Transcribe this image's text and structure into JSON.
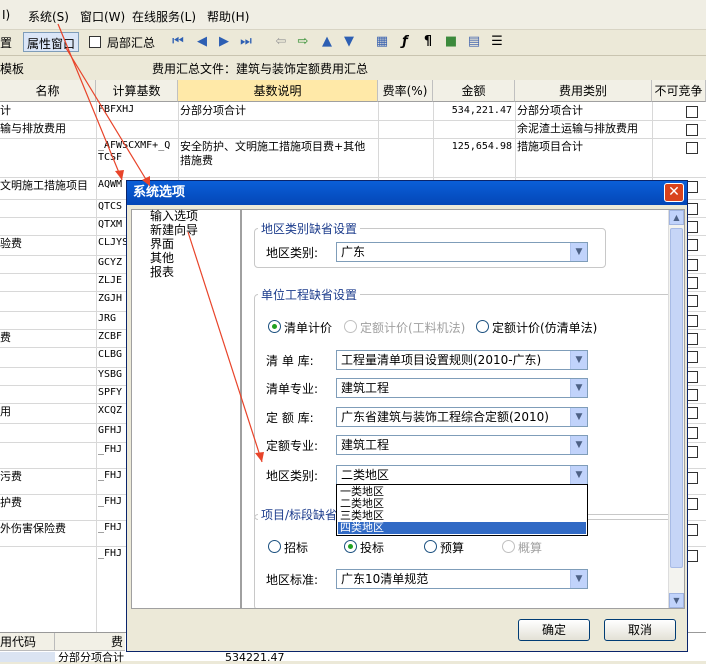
{
  "menubar": {
    "items": [
      "I)",
      "系统(S)",
      "窗口(W)",
      "在线服务(L)",
      "帮助(H)"
    ]
  },
  "toolbar": {
    "left_text": "置",
    "property_window": "属性窗口",
    "partial_summary": "局部汇总"
  },
  "infobar": {
    "left_text": "模板",
    "fee_summary": "费用汇总文件：建筑与装饰定额费用汇总"
  },
  "grid": {
    "headers": [
      "名称",
      "计算基数",
      "基数说明",
      "费率(%)",
      "金额",
      "费用类别",
      "不可竞争"
    ],
    "rows": [
      {
        "name": "计",
        "base": "FBFXHJ",
        "desc": "分部分项合计",
        "amount": "534,221.47",
        "category": "分部分项合计"
      },
      {
        "name": "输与排放费用",
        "base": "",
        "desc": "",
        "amount": "",
        "category": "余泥渣土运输与排放费用"
      },
      {
        "name": "",
        "base": "_AFWSCXMF+_Q TCSF",
        "desc": "安全防护、文明施工措施项目费+其他措施费",
        "amount": "125,654.98",
        "category": "措施项目合计"
      },
      {
        "name": "文明施工措施项目",
        "base": "AQWM",
        "desc": "",
        "amount": "",
        "category": ""
      },
      {
        "name": "",
        "base": "QTCS",
        "desc": "",
        "amount": "",
        "category": ""
      },
      {
        "name": "",
        "base": "QTXM",
        "desc": "",
        "amount": "",
        "category": ""
      },
      {
        "name": "验费",
        "base": "CLJYS",
        "desc": "",
        "amount": "",
        "category": ""
      },
      {
        "name": "",
        "base": "GCYZ",
        "desc": "",
        "amount": "",
        "category": ""
      },
      {
        "name": "",
        "base": "ZLJE",
        "desc": "",
        "amount": "",
        "category": ""
      },
      {
        "name": "",
        "base": "ZGJH",
        "desc": "",
        "amount": "",
        "category": ""
      },
      {
        "name": "",
        "base": "JRG",
        "desc": "",
        "amount": "",
        "category": ""
      },
      {
        "name": "费",
        "base": "ZCBF",
        "desc": "",
        "amount": "",
        "category": ""
      },
      {
        "name": "",
        "base": "CLBG",
        "desc": "",
        "amount": "",
        "category": ""
      },
      {
        "name": "",
        "base": "YSBG",
        "desc": "",
        "amount": "",
        "category": ""
      },
      {
        "name": "",
        "base": "SPFY",
        "desc": "",
        "amount": "",
        "category": ""
      },
      {
        "name": "用",
        "base": "XCQZ",
        "desc": "",
        "amount": "",
        "category": ""
      },
      {
        "name": "",
        "base": "GFHJ",
        "desc": "",
        "amount": "",
        "category": ""
      },
      {
        "name": "",
        "base": "_FHJ TXM",
        "desc": "",
        "amount": "",
        "category": ""
      },
      {
        "name": "污费",
        "base": "_FHJ TXM",
        "desc": "",
        "amount": "",
        "category": ""
      },
      {
        "name": "护费",
        "base": "_FHJ TXM",
        "desc": "",
        "amount": "",
        "category": ""
      },
      {
        "name": "外伤害保险费",
        "base": "_FHJ TXM",
        "desc": "",
        "amount": "",
        "category": ""
      },
      {
        "name": "",
        "base": "_FHJ TXM+",
        "desc": "",
        "amount": "",
        "category": ""
      }
    ]
  },
  "bottom": {
    "col1": "用代码",
    "col2": "费",
    "row_text": "分部分项合计",
    "row_amount": "534221.47"
  },
  "dialog": {
    "title": "系统选项",
    "nav": [
      "输入选项",
      "新建向导",
      "界面",
      "其他",
      "报表"
    ],
    "region_group_title": "地区类别缺省设置",
    "region_label": "地区类别:",
    "region_value": "广东",
    "unit_group_title": "单位工程缺省设置",
    "radio_bill": "清单计价",
    "radio_quota_labor": "定额计价(工料机法)",
    "radio_quota_bill": "定额计价(仿清单法)",
    "bill_lib_label": "清 单 库:",
    "bill_lib_value": "工程量清单项目设置规则(2010-广东)",
    "bill_spec_label": "清单专业:",
    "bill_spec_value": "建筑工程",
    "quota_lib_label": "定 额 库:",
    "quota_lib_value": "广东省建筑与装饰工程综合定额(2010)",
    "quota_spec_label": "定额专业:",
    "quota_spec_value": "建筑工程",
    "area_label": "地区类别:",
    "area_value": "二类地区",
    "area_options": [
      "一类地区",
      "二类地区",
      "三类地区",
      "四类地区"
    ],
    "area_selected_index": 3,
    "project_group_title": "项目/标段缺省",
    "radio_tender": "招标",
    "radio_bid": "投标",
    "radio_budget": "预算",
    "radio_estimate": "概算",
    "standard_label": "地区标准:",
    "standard_value": "广东10清单规范",
    "ok": "确定",
    "cancel": "取消"
  },
  "colors": {
    "title_bar": "#0A5FD8",
    "selection": "#316AC5",
    "annotation_arrow": "#E8442A",
    "header_highlight": "#FFE9A8"
  }
}
